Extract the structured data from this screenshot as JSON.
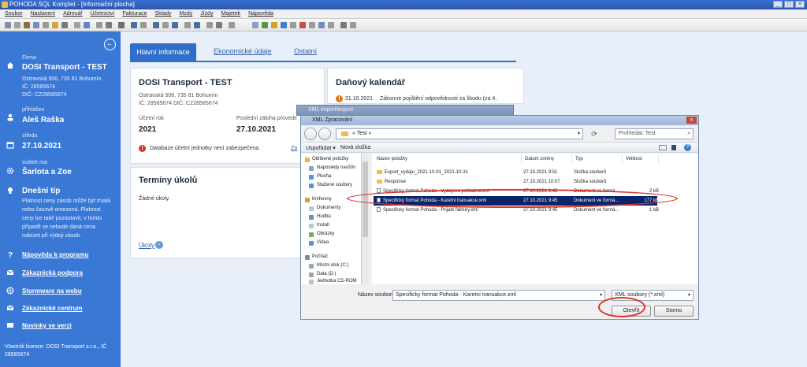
{
  "window": {
    "title": "POHODA SQL Komplet - [Informační plocha]"
  },
  "menu": [
    "Soubor",
    "Nastavení",
    "Adresář",
    "Účetnictví",
    "Fakturace",
    "Sklady",
    "Mzdy",
    "Jízdy",
    "Majetek",
    "Nápověda"
  ],
  "sidebar": {
    "company_label": "Firma",
    "company_name": "DOSI Transport - TEST",
    "company_address": "Ostravská 506, 735 81 Bohumín",
    "company_ic": "IČ: 28585674",
    "company_dic": "DIČ: CZ28585674",
    "user_label": "přihlášen",
    "user_name": "Aleš Raška",
    "day_label": "středa",
    "date": "27.10.2021",
    "nameday_label": "svátek má",
    "nameday": "Šarlota a Zoe",
    "tip_title": "Dnešní tip",
    "tip_lines": [
      "Platnost ceny zásob může být trvalá",
      "nebo časově omezená. Platnost",
      "ceny lze také pozastavit, v tomto",
      "případě se nebude daná cena",
      "nabízet při výdeji zásob."
    ],
    "links": [
      "Nápověda k programu",
      "Zákaznická podpora",
      "Stormware na webu",
      "Zákaznické centrum",
      "Novinky ve verzi"
    ],
    "footer": "Vlastník licence: DOSI Transport s.r.o., IČ 28585674"
  },
  "tabs": {
    "active": "Hlavní informace",
    "economic": "Ekonomické údaje",
    "other": "Ostatní"
  },
  "info_card": {
    "title": "DOSI Transport - TEST",
    "address": "Ostravská 506, 735 81 Bohumín",
    "ids": "IČ: 28585674  DIČ: CZ28585674",
    "year_label": "Účetní rok",
    "year": "2021",
    "backup_label": "Poslední záloha provede",
    "backup_date": "27.10.2021",
    "warning": "Databáze účetní jednotky není zabezpečena.",
    "more_link": "Za"
  },
  "tax_card": {
    "title": "Daňový kalendář",
    "date": "31.10.2021",
    "text": "Zákonné pojištění odpovědnosti za škodu (za 4."
  },
  "tasks_card": {
    "title": "Termíny úkolů",
    "empty": "Žádné úkoly.",
    "link": "Úkoly"
  },
  "dialog_back": {
    "title": "XML import/export"
  },
  "dialog": {
    "title": "XML Zpracování",
    "path": "« Test »",
    "search_placeholder": "Prohledat: Test",
    "cmd_organize": "Uspořádat ▾",
    "cmd_new_folder": "Nová složka",
    "nav": {
      "favorites": "Oblíbené položky",
      "recent": "Naposledy navštív",
      "desktop": "Plocha",
      "downloads": "Stažené soubory",
      "libraries": "Knihovny",
      "documents": "Dokumenty",
      "music": "Hudba",
      "install": "Install",
      "pictures": "Obrázky",
      "videos": "Videa",
      "computer": "Počítač",
      "disk_c": "Místní disk (C:)",
      "disk_d": "Data (D:)",
      "cdrom": "Jednotka CD-ROM"
    },
    "columns": [
      "Název položky",
      "Datum změny",
      "Typ",
      "Velikost"
    ],
    "files": [
      {
        "name": "Export_vydaju_2021-10-01_2021-10-31",
        "date": "27.10.2021 9:51",
        "type": "Složka souborů",
        "size": "",
        "folder": true,
        "selected": false
      },
      {
        "name": "Response",
        "date": "27.10.2021 10:07",
        "type": "Složka souborů",
        "size": "",
        "folder": true,
        "selected": false
      },
      {
        "name": "Specificky format Pohoda - Vydajova pokladna.xml",
        "date": "27.10.2021 9:45",
        "type": "Dokument ve formá...",
        "size": "2 kB",
        "folder": false,
        "selected": false
      },
      {
        "name": "Specificky format Pohoda - Karetni transakce.xml",
        "date": "27.10.2021 9:45",
        "type": "Dokument ve formá...",
        "size": "177 kB",
        "folder": false,
        "selected": true
      },
      {
        "name": "Specificky format Pohoda - Prijate faktury.xml",
        "date": "27.10.2021 9:45",
        "type": "Dokument ve formá...",
        "size": "1 kB",
        "folder": false,
        "selected": false
      }
    ],
    "filename_label": "Název souboru:",
    "filename": "Specificky format Pohoda - Karetni transakce.xml",
    "filter": "XML soubory (*.xml)",
    "open_button": "Otevřít",
    "cancel_button": "Storno"
  }
}
